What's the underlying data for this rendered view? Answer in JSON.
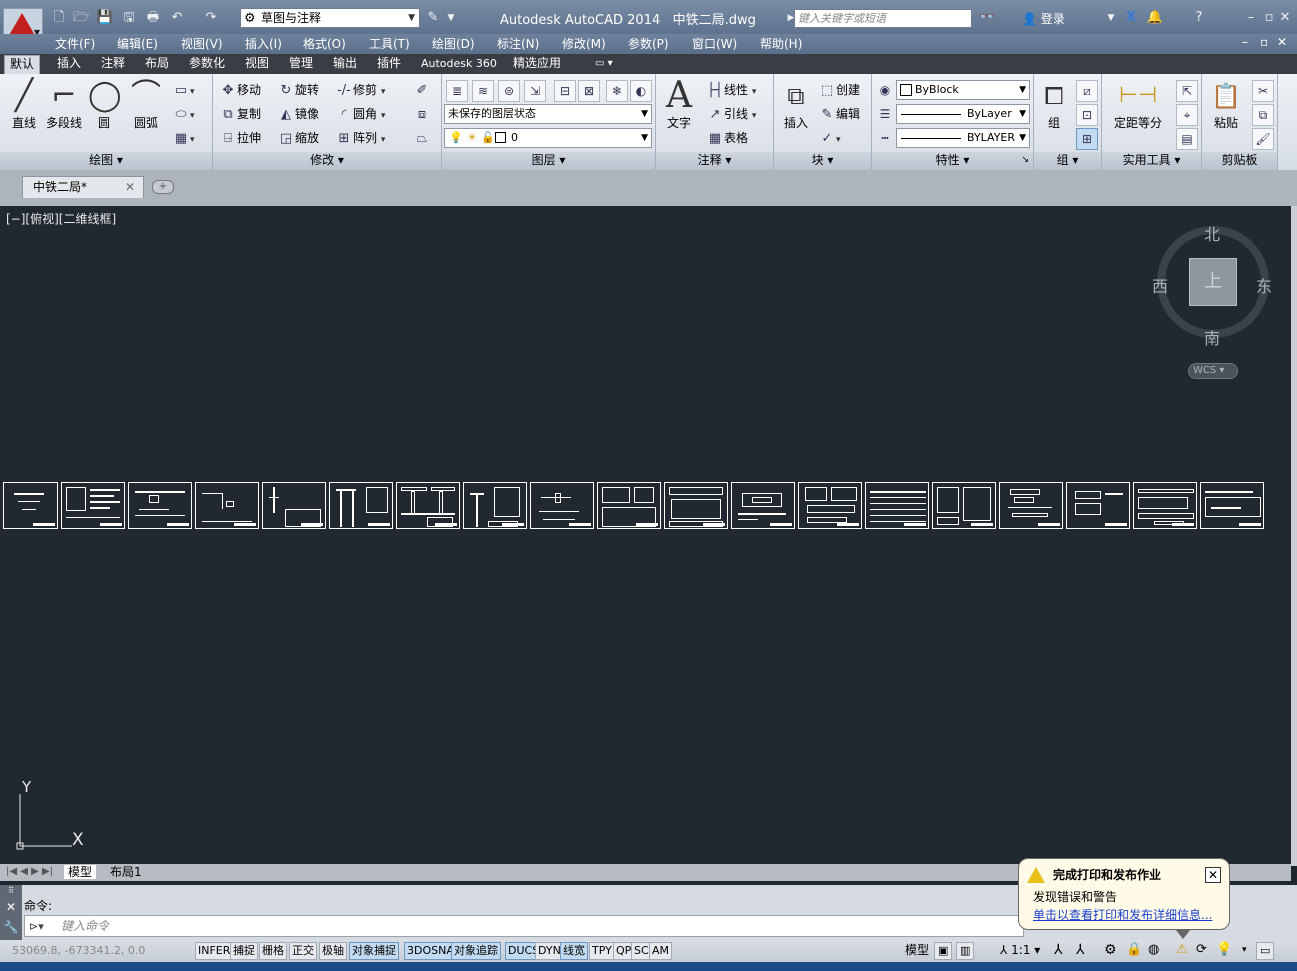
{
  "app": {
    "title": "Autodesk AutoCAD 2014",
    "filename": "中铁二局.dwg",
    "workspace": "草图与注释",
    "search_placeholder": "键入关键字或短语",
    "login": "登录"
  },
  "menubar": [
    "文件(F)",
    "编辑(E)",
    "视图(V)",
    "插入(I)",
    "格式(O)",
    "工具(T)",
    "绘图(D)",
    "标注(N)",
    "修改(M)",
    "参数(P)",
    "窗口(W)",
    "帮助(H)"
  ],
  "ribbon_tabs": [
    "默认",
    "插入",
    "注释",
    "布局",
    "参数化",
    "视图",
    "管理",
    "输出",
    "插件",
    "Autodesk 360",
    "精选应用"
  ],
  "panels": {
    "draw": {
      "title": "绘图",
      "tools": [
        "直线",
        "多段线",
        "圆",
        "圆弧"
      ]
    },
    "modify": {
      "title": "修改",
      "tools": [
        "移动",
        "旋转",
        "修剪",
        "复制",
        "镜像",
        "圆角",
        "拉伸",
        "缩放",
        "阵列"
      ]
    },
    "layers": {
      "title": "图层",
      "layer_state": "未保存的图层状态",
      "current_layer": "0"
    },
    "annotation": {
      "title": "注释",
      "tools": [
        "文字",
        "线性",
        "引线",
        "表格"
      ]
    },
    "block": {
      "title": "块",
      "tools": [
        "插入",
        "创建",
        "编辑"
      ]
    },
    "properties": {
      "title": "特性",
      "color": "ByBlock",
      "linetype": "ByLayer",
      "lineweight": "BYLAYER"
    },
    "groups": {
      "title": "组",
      "tools": [
        "组"
      ]
    },
    "utilities": {
      "title": "实用工具",
      "tools": [
        "定距等分"
      ]
    },
    "clipboard": {
      "title": "剪贴板",
      "tools": [
        "粘贴"
      ]
    }
  },
  "document_tab": "中铁二局*",
  "viewport_label": "[−][俯视][二维线框]",
  "viewcube": {
    "north": "北",
    "south": "南",
    "east": "东",
    "west": "西",
    "face": "上",
    "wcs": "WCS"
  },
  "ucs": {
    "x": "X",
    "y": "Y"
  },
  "layout_tabs": [
    "模型",
    "布局1"
  ],
  "command": {
    "history": "命令:",
    "placeholder": "键入命令"
  },
  "status": {
    "coords": "53069.8,  -673341.2, 0.0",
    "toggles": [
      {
        "label": "INFER",
        "on": false
      },
      {
        "label": "捕捉",
        "on": false
      },
      {
        "label": "栅格",
        "on": false
      },
      {
        "label": "正交",
        "on": false
      },
      {
        "label": "极轴",
        "on": false
      },
      {
        "label": "对象捕捉",
        "on": true
      },
      {
        "label": "3DOSNAP",
        "on": true
      },
      {
        "label": "对象追踪",
        "on": true
      },
      {
        "label": "DUCS",
        "on": true
      },
      {
        "label": "DYN",
        "on": false
      },
      {
        "label": "线宽",
        "on": true
      },
      {
        "label": "TPY",
        "on": false
      },
      {
        "label": "QP",
        "on": false
      },
      {
        "label": "SC",
        "on": false
      },
      {
        "label": "AM",
        "on": false
      }
    ],
    "model": "模型",
    "scale": "1:1"
  },
  "notification": {
    "title": "完成打印和发布作业",
    "body": "发现错误和警告",
    "link": "单击以查看打印和发布详细信息..."
  }
}
